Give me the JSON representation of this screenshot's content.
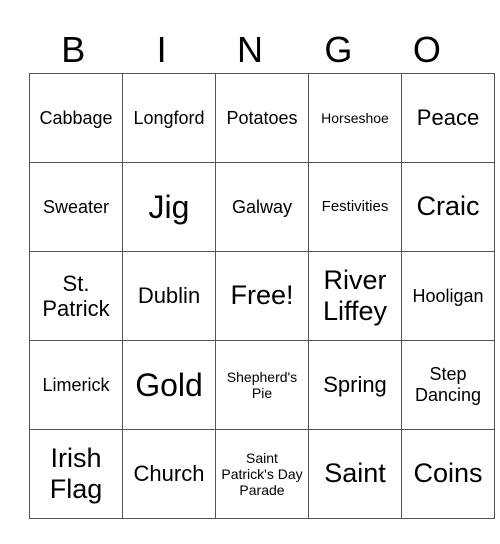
{
  "header": {
    "letters": [
      "B",
      "I",
      "N",
      "G",
      "O"
    ]
  },
  "card": {
    "rows": [
      [
        "Cabbage",
        "Longford",
        "Potatoes",
        "Horseshoe",
        "Peace"
      ],
      [
        "Sweater",
        "Jig",
        "Galway",
        "Festivities",
        "Craic"
      ],
      [
        "St. Patrick",
        "Dublin",
        "Free!",
        "River Liffey",
        "Hooligan"
      ],
      [
        "Limerick",
        "Gold",
        "Shepherd's Pie",
        "Spring",
        "Step Dancing"
      ],
      [
        "Irish Flag",
        "Church",
        "Saint Patrick's Day Parade",
        "Saint",
        "Coins"
      ]
    ]
  }
}
